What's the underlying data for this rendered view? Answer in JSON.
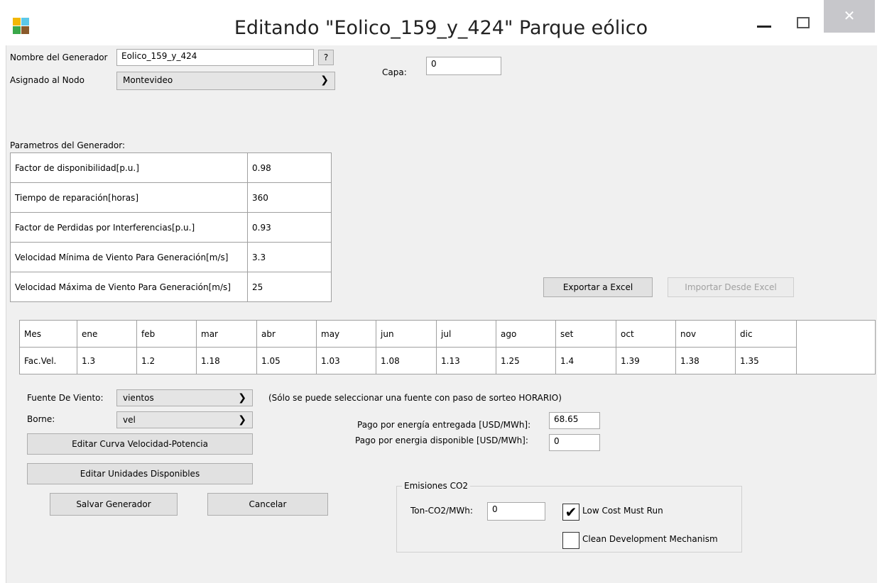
{
  "window": {
    "title": "Editando \"Eolico_159_y_424\" Parque eólico",
    "minimize": "—",
    "maximize": "☐",
    "close": "✕"
  },
  "generator": {
    "name_label": "Nombre del Generador",
    "name_value": "Eolico_159_y_424",
    "help_button": "?",
    "node_label": "Asignado al Nodo",
    "node_value": "Montevideo",
    "capa_label": "Capa:",
    "capa_value": "0"
  },
  "params": {
    "section_label": "Parametros del Generador:",
    "rows": [
      {
        "label": "Factor de disponibilidad[p.u.]",
        "value": "0.98"
      },
      {
        "label": "Tiempo de reparación[horas]",
        "value": "360"
      },
      {
        "label": "Factor de Perdidas por Interferencias[p.u.]",
        "value": "0.93"
      },
      {
        "label": "Velocidad Mínima de Viento Para Generación[m/s]",
        "value": "3.3"
      },
      {
        "label": "Velocidad Máxima de Viento Para Generación[m/s]",
        "value": "25"
      }
    ]
  },
  "excel": {
    "export_label": "Exportar a Excel",
    "import_label": "Importar Desde Excel"
  },
  "months_table": {
    "header": [
      "Mes",
      "ene",
      "feb",
      "mar",
      "abr",
      "may",
      "jun",
      "jul",
      "ago",
      "set",
      "oct",
      "nov",
      "dic"
    ],
    "row": [
      "Fac.Vel.",
      "1.3",
      "1.2",
      "1.18",
      "1.05",
      "1.03",
      "1.08",
      "1.13",
      "1.25",
      "1.4",
      "1.39",
      "1.38",
      "1.35"
    ]
  },
  "wind": {
    "source_label": "Fuente De Viento:",
    "source_value": "vientos",
    "borne_label": "Borne:",
    "borne_value": "vel",
    "note": "(Sólo se puede seleccionar una fuente con paso de sorteo HORARIO)"
  },
  "payments": {
    "delivered_label": "Pago por energía entregada [USD/MWh]:",
    "delivered_value": "68.65",
    "available_label": "Pago por energia disponible [USD/MWh]:",
    "available_value": "0"
  },
  "buttons": {
    "edit_curve": "Editar Curva Velocidad-Potencia",
    "edit_units": "Editar Unidades Disponibles",
    "save": "Salvar Generador",
    "cancel": "Cancelar"
  },
  "emissions": {
    "group_label": "Emisiones CO2",
    "ton_label": "Ton-CO2/MWh:",
    "ton_value": "0",
    "low_cost_label": "Low Cost Must Run",
    "low_cost_checked": true,
    "cdm_label": "Clean Development Mechanism",
    "cdm_checked": false
  },
  "colors": {
    "logo": [
      "#f5a623",
      "#7ed321",
      "#4a90e2",
      "#d0021b"
    ]
  }
}
